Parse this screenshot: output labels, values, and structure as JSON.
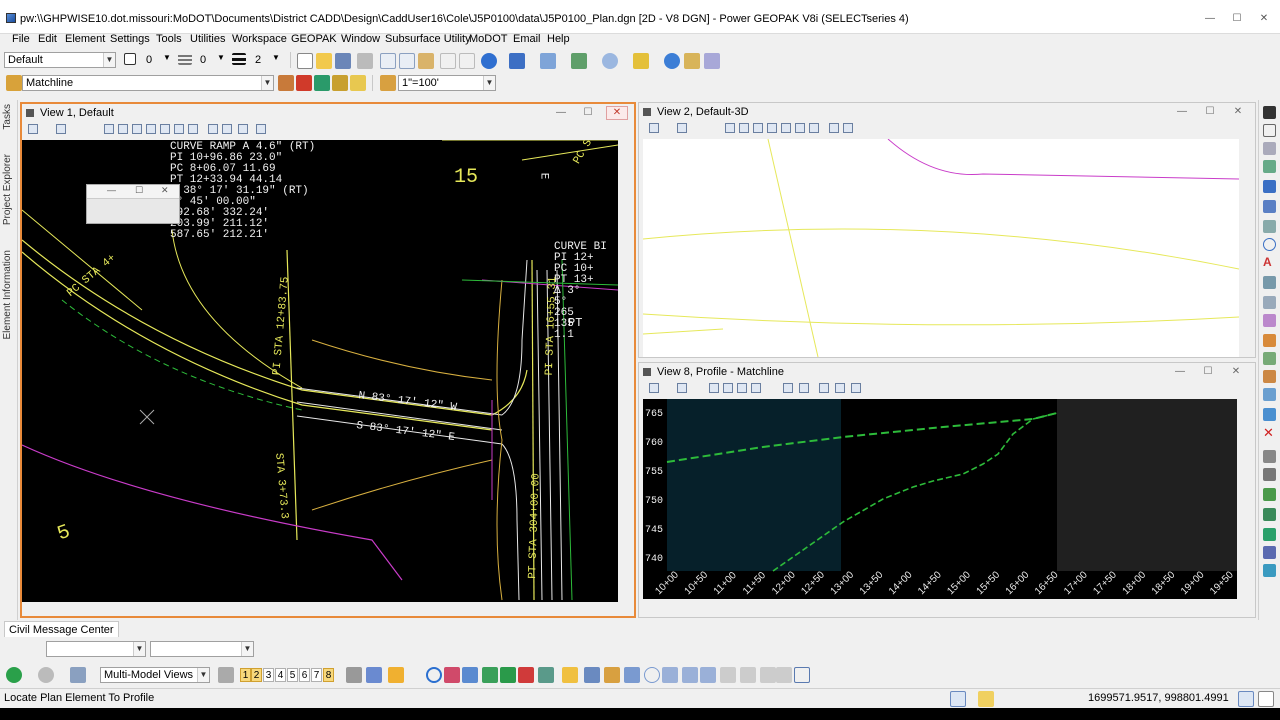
{
  "window": {
    "title": "pw:\\\\GHPWISE10.dot.missouri:MoDOT\\Documents\\District CADD\\Design\\CaddUser16\\Cole\\J5P0100\\data\\J5P0100_Plan.dgn [2D - V8 DGN] - Power GEOPAK V8i (SELECTseries 4)",
    "minimize": "—",
    "maximize": "☐",
    "close": "✕"
  },
  "menu": [
    "File",
    "Edit",
    "Element",
    "Settings",
    "Tools",
    "Utilities",
    "Workspace",
    "GEOPAK",
    "Window",
    "Subsurface Utility",
    "MoDOT",
    "Email",
    "Help"
  ],
  "attributes": {
    "level": "Default",
    "color": "0",
    "style": "0",
    "weight": "2"
  },
  "tool_settings": {
    "feature": "Matchline",
    "scale": "1\"=100'"
  },
  "left_tabs": [
    "Tasks",
    "Project Explorer",
    "Element Information"
  ],
  "views": {
    "view1": {
      "title": "View 1, Default"
    },
    "view2": {
      "title": "View 2, Default-3D"
    },
    "view8": {
      "title": "View 8, Profile - Matchline"
    }
  },
  "icons": {
    "min": "—",
    "max": "☐",
    "close": "✕"
  },
  "cad_text": {
    "curve_data_left": [
      "CURVE  RAMP  A  4.6\" (RT)",
      "PI   10+96.86  23.0\"",
      "PC    8+06.07  11.69",
      "PT   12+33.94  44.14",
      "Δ    38° 17' 31.19\" (RT)",
      "     9° 45' 00.00\"",
      "    392.68' 332.24'",
      "    203.99' 211.12'",
      "    587.65' 212.21'"
    ],
    "curve_b": [
      "CURVE BI",
      "PI    12+",
      "PC    10+",
      "PT    13+",
      "Δ     3°",
      "      5°",
      "      265",
      "      135",
      "      1.1"
    ],
    "letters_pi": [
      "PI",
      "PC",
      "PT",
      "Δ",
      "D",
      "T",
      "L",
      "R"
    ],
    "road_n": "N 83° 17' 12\" W",
    "road_s": "S 83° 17' 12\" E",
    "sta_left": "PC STA 4+",
    "sta_mid": "PI STA 12+83.75",
    "sta_mid2": "STA 3+73.3",
    "sta_right": "PI STA 16+55.31",
    "sta_right2": "PT STA 304+00.00",
    "sheet_15": "15",
    "sheet_5": "5",
    "pt_label": "PT",
    "pc_label": "PC S",
    "e_label": "E",
    "b_label": "B"
  },
  "profile": {
    "elevations": [
      "765",
      "760",
      "755",
      "750",
      "745",
      "740"
    ],
    "stations": [
      "10+00",
      "10+50",
      "11+00",
      "11+50",
      "12+00",
      "12+50",
      "13+00",
      "13+50",
      "14+00",
      "14+50",
      "15+00",
      "15+50",
      "16+00",
      "16+50",
      "17+00",
      "17+50",
      "18+00",
      "18+50",
      "19+00",
      "19+50"
    ],
    "line_color": "#2dbb3a"
  },
  "message_center": {
    "tab": "Civil Message Center"
  },
  "bottom_toolbar": {
    "views_combo": "Multi-Model Views",
    "view_numbers": [
      "1",
      "2",
      "3",
      "4",
      "5",
      "6",
      "7",
      "8"
    ],
    "active_views": [
      "1",
      "2",
      "8"
    ]
  },
  "status": {
    "prompt": "Locate Plan Element To Profile",
    "coords": "1699571.9517, 998801.4991"
  },
  "colors": {
    "active_border": "#e88a3a",
    "cad_background": "#000000",
    "yellow_line": "#e6e85a",
    "magenta_line": "#c93cc9",
    "green_line": "#2dbb3a",
    "white_line": "#e8e8e8"
  }
}
